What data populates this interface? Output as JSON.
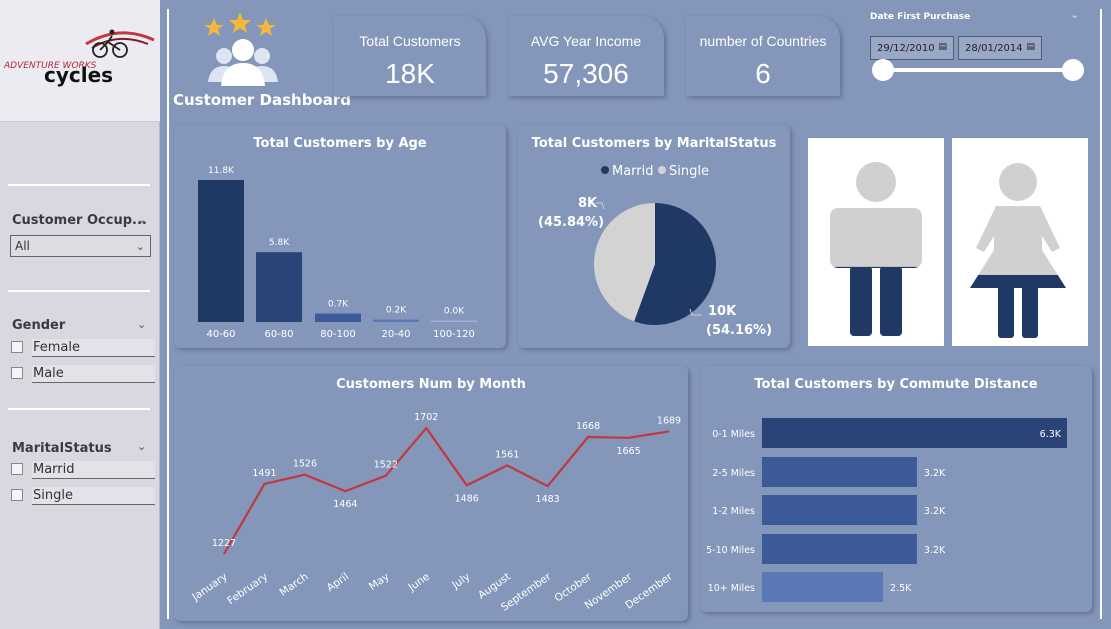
{
  "brand": {
    "logo_text_top": "ADVENTURE WORKS",
    "logo_text_main": "cycles"
  },
  "dashboard": {
    "title": "Customer Dashboard"
  },
  "kpis": [
    {
      "title": "Total Customers",
      "value": "18K"
    },
    {
      "title": "AVG Year Income",
      "value": "57,306"
    },
    {
      "title": "number of Countries",
      "value": "6"
    }
  ],
  "date_filter": {
    "label": "Date First Purchase",
    "start": "29/12/2010",
    "end": "28/01/2014"
  },
  "slicers": {
    "occupation": {
      "title": "Customer Occup...",
      "selected": "All"
    },
    "gender": {
      "title": "Gender",
      "options": [
        "Female",
        "Male"
      ]
    },
    "marital": {
      "title": "MaritalStatus",
      "options": [
        "Marrid",
        "Single"
      ]
    }
  },
  "colors": {
    "dark_navy": "#203864",
    "mid_blue": "#2b4478",
    "bar_blue": "#3c5a99",
    "light_blue": "#5a78b5",
    "line_red": "#c0393b",
    "pie_grey": "#d3d3d3",
    "bg": "#8496ba"
  },
  "chart_data": [
    {
      "type": "bar",
      "title": "Total Customers by Age",
      "categories": [
        "40-60",
        "60-80",
        "80-100",
        "20-40",
        "100-120"
      ],
      "values": [
        11.8,
        5.8,
        0.7,
        0.2,
        0.0
      ],
      "value_labels": [
        "11.8K",
        "5.8K",
        "0.7K",
        "0.2K",
        "0.0K"
      ],
      "unit": "K"
    },
    {
      "type": "pie",
      "title": "Total Customers by MaritalStatus",
      "legend": [
        "Marrid",
        "Single"
      ],
      "slices": [
        {
          "name": "Marrid",
          "value": 10,
          "value_label": "10K",
          "pct_label": "(54.16%)"
        },
        {
          "name": "Single",
          "value": 8,
          "value_label": "8K",
          "pct_label": "(45.84%)"
        }
      ]
    },
    {
      "type": "line",
      "title": "Customers Num by Month",
      "categories": [
        "January",
        "February",
        "March",
        "April",
        "May",
        "June",
        "July",
        "August",
        "September",
        "October",
        "November",
        "December"
      ],
      "values": [
        1227,
        1491,
        1526,
        1464,
        1522,
        1702,
        1486,
        1561,
        1483,
        1668,
        1665,
        1689
      ]
    },
    {
      "type": "bar",
      "orientation": "horizontal",
      "title": "Total Customers by Commute Distance",
      "categories": [
        "0-1 Miles",
        "2-5 Miles",
        "1-2 Miles",
        "5-10 Miles",
        "10+ Miles"
      ],
      "values": [
        6.3,
        3.2,
        3.2,
        3.2,
        2.5
      ],
      "value_labels": [
        "6.3K",
        "3.2K",
        "3.2K",
        "3.2K",
        "2.5K"
      ]
    }
  ],
  "gender_fill": {
    "male": 0.54,
    "female": 0.46
  }
}
